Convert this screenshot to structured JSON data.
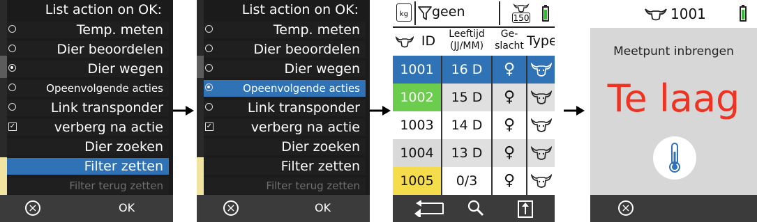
{
  "menu1": {
    "title": "List action on OK:",
    "items": [
      {
        "label": "Temp. meten",
        "control": "radio",
        "checked": false
      },
      {
        "label": "Dier beoordelen",
        "control": "radio",
        "checked": false
      },
      {
        "label": "Dier wegen",
        "control": "radio",
        "checked": true
      },
      {
        "label": "Opeenvolgende acties",
        "control": "radio",
        "checked": false
      },
      {
        "label": "Link transponder",
        "control": "radio",
        "checked": false
      },
      {
        "label": "verberg na actie",
        "control": "checkbox",
        "checked": true
      },
      {
        "label": "Dier zoeken"
      },
      {
        "label": "Filter zetten",
        "selected": true
      },
      {
        "label": "Filter terug zetten",
        "disabled": true
      }
    ],
    "cancel_icon": "cancel-circle-icon",
    "ok_label": "OK"
  },
  "menu2": {
    "title": "List action on OK:",
    "items": [
      {
        "label": "Temp. meten",
        "control": "radio",
        "checked": false
      },
      {
        "label": "Dier beoordelen",
        "control": "radio",
        "checked": false
      },
      {
        "label": "Dier wegen",
        "control": "radio",
        "checked": false
      },
      {
        "label": "Opeenvolgende acties",
        "control": "radio",
        "checked": true,
        "selected": true
      },
      {
        "label": "Link transponder",
        "control": "radio",
        "checked": false
      },
      {
        "label": "verberg na actie",
        "control": "checkbox",
        "checked": true
      },
      {
        "label": "Dier zoeken"
      },
      {
        "label": "Filter zetten"
      },
      {
        "label": "Filter terug zetten",
        "disabled": true
      }
    ],
    "cancel_icon": "cancel-circle-icon",
    "ok_label": "OK"
  },
  "list": {
    "header": {
      "scale_unit": "kg",
      "filter_icon": "filter-icon",
      "filter_value": "geen",
      "count": "150",
      "battery_icon": "battery-icon"
    },
    "columns": {
      "id": "ID",
      "age_line1": "Leeftijd",
      "age_line2": "(JJ/MM)",
      "sex_line1": "Ge-",
      "sex_line2": "slacht",
      "type": "Type"
    },
    "rows": [
      {
        "id": "1001",
        "age": "16 D",
        "sex": "♀",
        "type_icon": "cow-head-icon",
        "color": "#2f72b6",
        "text_color": "#ffffff",
        "highlight": true
      },
      {
        "id": "1002",
        "age": "15 D",
        "sex": "♀",
        "type_icon": "cow-head-icon",
        "color": "#6ccc4e",
        "text_color": "#ffffff"
      },
      {
        "id": "1003",
        "age": "14 D",
        "sex": "♀",
        "type_icon": "cow-head-icon",
        "color": "#ffffff",
        "text_color": "#111111"
      },
      {
        "id": "1004",
        "age": "13 D",
        "sex": "♀",
        "type_icon": "cow-head-icon",
        "color": "#d9d9d9",
        "text_color": "#111111"
      },
      {
        "id": "1005",
        "age": "0/3",
        "sex": "♀",
        "type_icon": "cow-head-icon",
        "color": "#f5dc4a",
        "text_color": "#111111"
      }
    ],
    "footer": {
      "back_icon": "back-arrow-icon",
      "search_icon": "search-icon",
      "export_icon": "export-icon"
    }
  },
  "measure": {
    "animal_icon": "cow-head-icon",
    "animal_id": "1001",
    "prompt": "Meetpunt inbrengen",
    "status": "Te laag",
    "status_color": "#ee3322",
    "thermometer_icon": "thermometer-icon",
    "cancel_icon": "cancel-circle-icon"
  }
}
